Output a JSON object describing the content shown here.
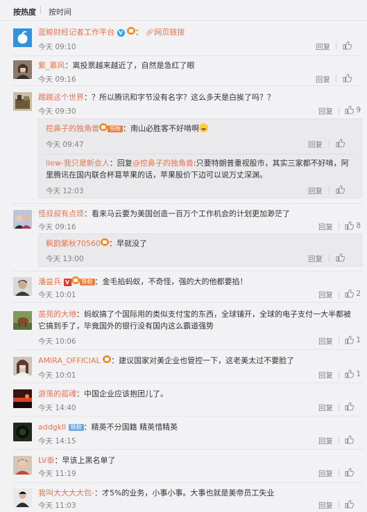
{
  "sort": {
    "hot": "按热度",
    "time": "按时间"
  },
  "ui": {
    "reply": "回复"
  },
  "comments": [
    {
      "name": "蓝鲸财经记者工作平台",
      "sep": "：",
      "link_text": "网页链接",
      "time": "今天 09:10",
      "likes": ""
    },
    {
      "name": "紫_慕风",
      "text": "：离投票越来越近了，自然是急红了眼",
      "time": "今天 09:16",
      "likes": ""
    },
    {
      "name": "踢踢这个世界",
      "text": "：？所以腾讯和字节没有名字？这么多天是白挨了吗？？",
      "time": "今天 09:30",
      "likes": "9",
      "subs": [
        {
          "name": "挖鼻子的独角兽",
          "tag": "铁粉",
          "text": "：南山必胜客不好啃啊",
          "time": "今天 09:47"
        },
        {
          "name": "liew-我只是新会人",
          "text": "：回复",
          "mention": "@挖鼻子的独角兽",
          "text2": ":只要特朗普重视股市，其实三家都不好啃，阿里腾讯在国内联合杯葛苹果的话，苹果股价下边可以说万丈深渊。",
          "time": "今天 12:03"
        }
      ]
    },
    {
      "name": "怪叔叔有点烦",
      "text": "：看来马云要为美国创造一百万个工作机会的计划更加渺茫了",
      "time": "今天 09:16",
      "likes": "8",
      "subs": [
        {
          "name": "枫韵紫秋70560",
          "text": "：早就没了",
          "time": "今天 13:00"
        }
      ]
    },
    {
      "name": "潘益兵",
      "tag": "铁粉",
      "text": "：金毛掐蚂蚁，不奇怪，强的大的他都要掐！",
      "time": "今天 10:01",
      "likes": "2"
    },
    {
      "name": "苗苑的大地",
      "text": "：蚂蚁搞了个国际用的类似支付宝的东西，全球铺开，全球的电子支付一大半都被它搞到手了，毕竟国外的银行没有国内这么霸道强势",
      "time": "今天 10:06",
      "likes": "1"
    },
    {
      "name": "AMIRA_OFFICIAL",
      "text": "：建议国家对美企业也管控一下，这老美太过不要脸了",
      "time": "今天 10:01",
      "likes": "1"
    },
    {
      "name": "游荡的孤魂",
      "text": "：中国企业应该抱团儿了。",
      "time": "今天 14:40",
      "likes": ""
    },
    {
      "name": "addgkll",
      "tag": "铁粉",
      "text": "：精英不分国籍 精英惜精英",
      "time": "今天 14:15",
      "likes": ""
    },
    {
      "name": "LV泰",
      "text": "：早该上黑名单了",
      "time": "今天 11:19",
      "likes": ""
    },
    {
      "name": "我叫大大大大包-",
      "text": "：才5%的业务，小事小事。大事也就是美帝员工失业",
      "time": "今天 11:03",
      "likes": ""
    }
  ],
  "colors": {
    "accent": "#eb7350",
    "muted": "#808080",
    "bg": "#f2f2f5"
  }
}
